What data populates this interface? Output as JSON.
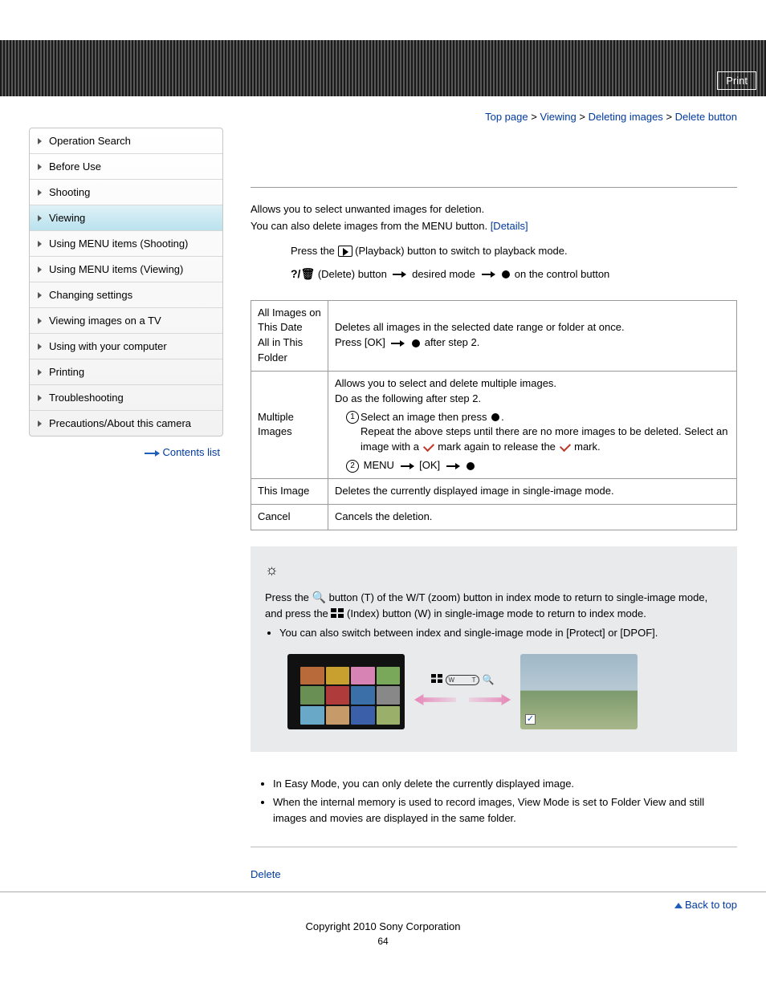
{
  "header": {
    "print": "Print"
  },
  "breadcrumb": {
    "p1": "Top page",
    "p2": "Viewing",
    "p3": "Deleting images",
    "p4": "Delete button"
  },
  "sidebar": {
    "items": [
      "Operation Search",
      "Before Use",
      "Shooting",
      "Viewing",
      "Using MENU items (Shooting)",
      "Using MENU items (Viewing)",
      "Changing settings",
      "Viewing images on a TV",
      "Using with your computer",
      "Printing",
      "Troubleshooting",
      "Precautions/About this camera"
    ],
    "active_index": 3,
    "contents": "Contents list"
  },
  "intro": {
    "l1": "Allows you to select unwanted images for deletion.",
    "l2a": "You can also delete images from the MENU button. ",
    "l2b": "[Details]"
  },
  "steps": {
    "s1a": "Press the ",
    "s1b": "(Playback) button to switch to playback mode.",
    "s2a": "(Delete) button",
    "s2b": "desired mode",
    "s2c": "on the control button"
  },
  "table": {
    "r1": {
      "lbl_a": "All Images on This Date",
      "lbl_b": "All in This Folder",
      "d1": "Deletes all images in the selected date range or folder at once.",
      "d2a": "Press [OK] ",
      "d2b": " after step 2."
    },
    "r2": {
      "lbl": "Multiple Images",
      "d1": "Allows you to select and delete multiple images.",
      "d2": "Do as the following after step 2.",
      "s1a": "Select an image then press ",
      "s1b": ".",
      "s1c": "Repeat the above steps until there are no more images to be deleted. Select an image with a ",
      "s1d": " mark again to release the ",
      "s1e": " mark.",
      "s2a": "MENU ",
      "s2b": " [OK] "
    },
    "r3": {
      "lbl": "This Image",
      "d": "Deletes the currently displayed image in single-image mode."
    },
    "r4": {
      "lbl": "Cancel",
      "d": "Cancels the deletion."
    }
  },
  "hint": {
    "p1a": "Press the ",
    "p1b": " button (T) of the W/T (zoom) button in index mode to return to single-image mode, and press the ",
    "p1c": "(Index) button (W) in single-image mode to return to index mode.",
    "b1": "You can also switch between index and single-image mode in [Protect] or [DPOF]."
  },
  "notes": {
    "n1": "In Easy Mode, you can only delete the currently displayed image.",
    "n2": "When the internal memory is used to record images, View Mode is set to Folder View and still images and movies are displayed in the same folder."
  },
  "related": "Delete",
  "back_top": "Back to top",
  "copyright": "Copyright 2010 Sony Corporation",
  "pagenum": "64",
  "chart_data": {
    "type": "table",
    "rows": [
      {
        "mode": "All Images on This Date / All in This Folder",
        "description": "Deletes all images in the selected date range or folder at once. Press [OK] → ● after step 2."
      },
      {
        "mode": "Multiple Images",
        "description": "Allows you to select and delete multiple images. ①Select an image then press ●. Repeat until no more images to be deleted. Select an image with a ✓ mark again to release the ✓ mark. ② MENU → [OK] → ●"
      },
      {
        "mode": "This Image",
        "description": "Deletes the currently displayed image in single-image mode."
      },
      {
        "mode": "Cancel",
        "description": "Cancels the deletion."
      }
    ]
  }
}
